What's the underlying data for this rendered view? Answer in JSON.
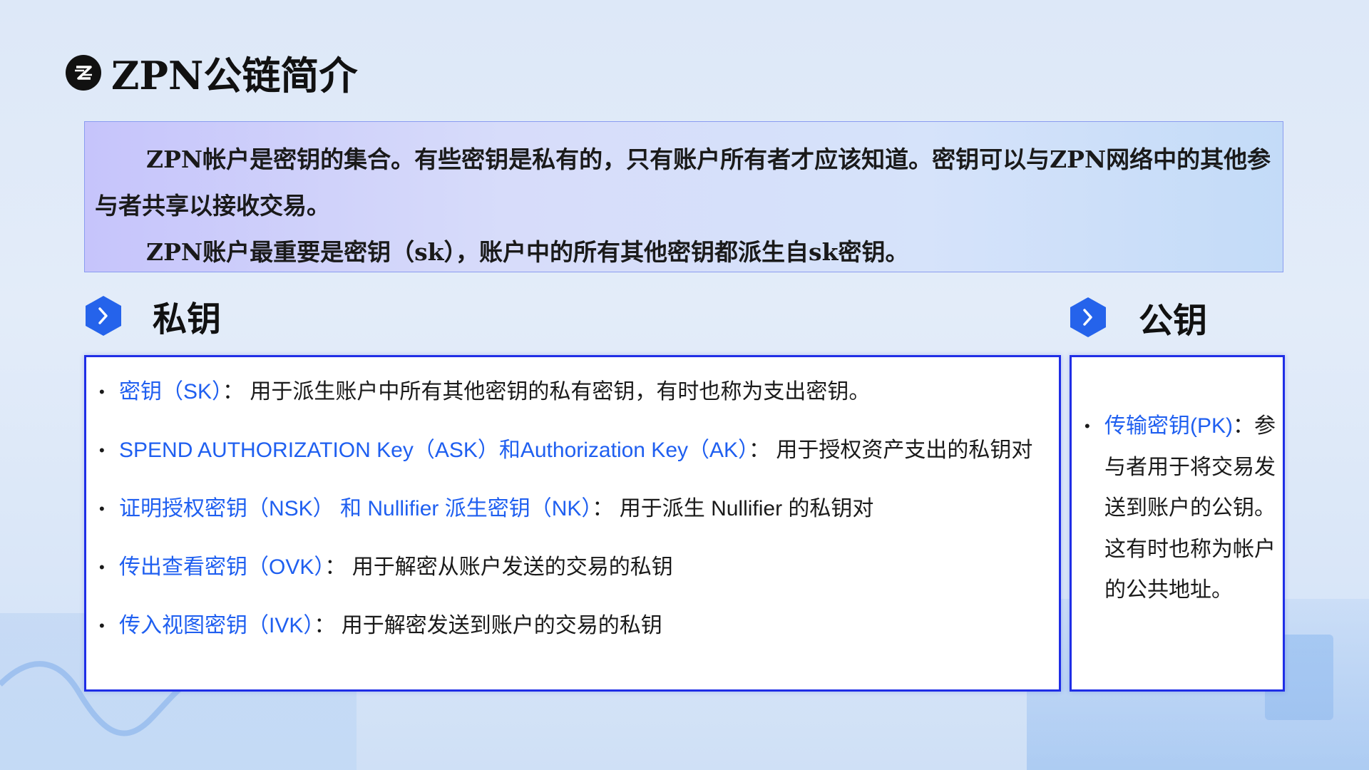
{
  "title": "ZPN公链简介",
  "intro": {
    "paragraph1": "ZPN帐户是密钥的集合。有些密钥是私有的，只有账户所有者才应该知道。密钥可以与ZPN网络中的其他参与者共享以接收交易。",
    "paragraph2": "ZPN账户最重要是密钥（sk），账户中的所有其他密钥都派生自sk密钥。"
  },
  "private_section": {
    "title": "私钥",
    "items": [
      {
        "term": "密钥（SK）",
        "sep": "： ",
        "desc": "用于派生账户中所有其他密钥的私有密钥，有时也称为支出密钥。"
      },
      {
        "term": "SPEND AUTHORIZATION Key（ASK）和Authorization Key（AK）",
        "sep": "： ",
        "desc": "用于授权资产支出的私钥对"
      },
      {
        "term": "证明授权密钥（NSK） 和 Nullifier 派生密钥（NK）",
        "sep": "： ",
        "desc": "用于派生 Nullifier 的私钥对"
      },
      {
        "term": "传出查看密钥（OVK）",
        "sep": "： ",
        "desc": "用于解密从账户发送的交易的私钥"
      },
      {
        "term": "传入视图密钥（IVK）",
        "sep": "： ",
        "desc": "用于解密发送到账户的交易的私钥"
      }
    ]
  },
  "public_section": {
    "title": "公钥",
    "items": [
      {
        "term": "传输密钥(PK)",
        "sep": "：",
        "desc": "参与者用于将交易发送到账户的公钥。这有时也称为帐户的公共地址。"
      }
    ]
  },
  "icons": {
    "logo": "zpn-logo-icon",
    "section_marker": "chevron-right-icon"
  },
  "colors": {
    "accent": "#1f5ff0",
    "box_border": "#1f2ee6",
    "chevron_bg": "#2563eb"
  }
}
